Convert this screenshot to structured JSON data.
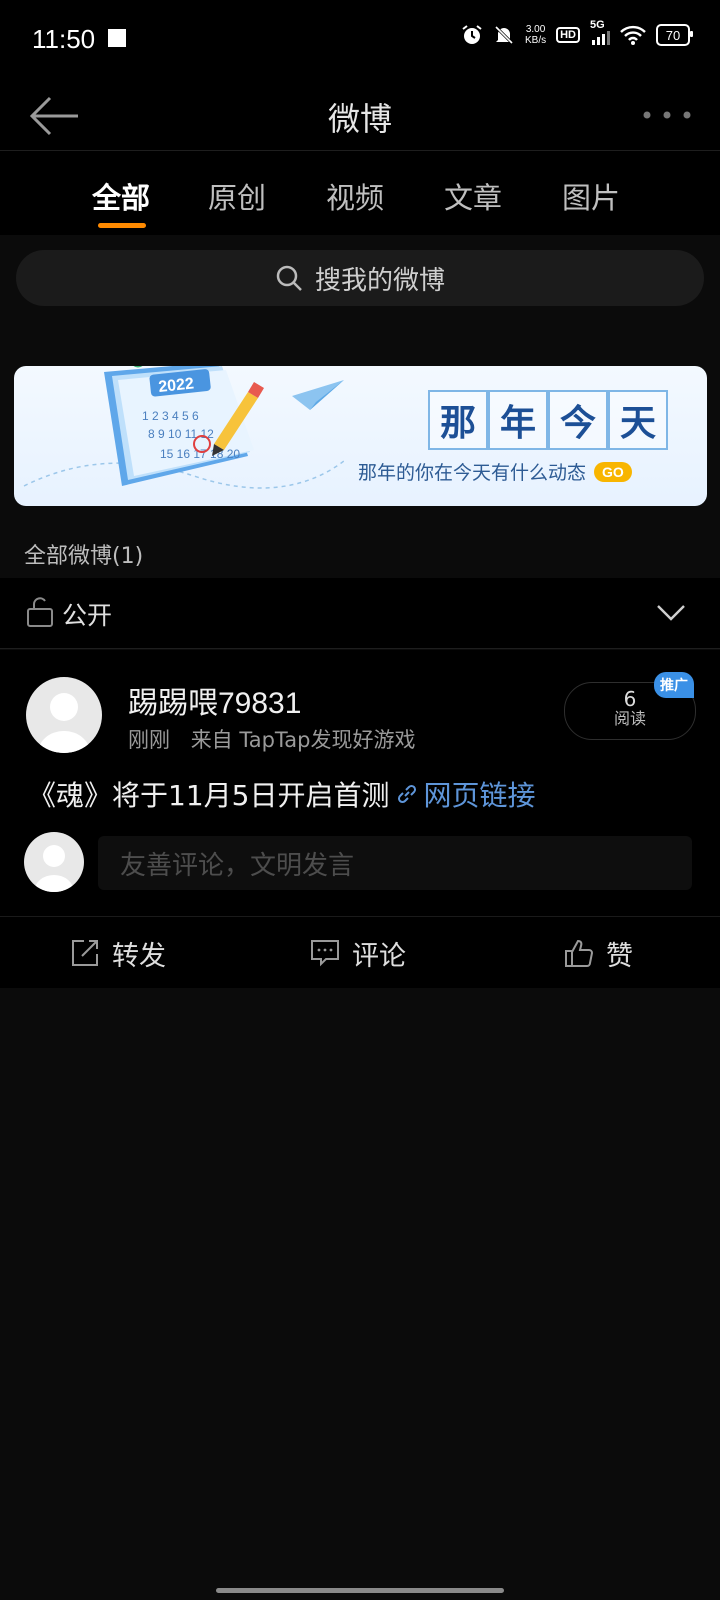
{
  "status": {
    "time": "11:50",
    "net_speed": "3.00",
    "net_unit": "KB/s",
    "hd": "HD",
    "signal": "5G",
    "battery": "70"
  },
  "header": {
    "title": "微博"
  },
  "tabs": [
    {
      "label": "全部",
      "active": true
    },
    {
      "label": "原创"
    },
    {
      "label": "视频"
    },
    {
      "label": "文章"
    },
    {
      "label": "图片"
    }
  ],
  "search": {
    "placeholder": "搜我的微博"
  },
  "banner": {
    "year": "2022",
    "title_chars": [
      "那",
      "年",
      "今",
      "天"
    ],
    "subtitle": "那年的你在今天有什么动态",
    "go": "GO"
  },
  "section": {
    "label": "全部微博(1)"
  },
  "privacy": {
    "label": "公开"
  },
  "post": {
    "user_name": "踢踢喂79831",
    "meta_time": "刚刚",
    "meta_source": "来自 TapTap发现好游戏",
    "read_count": "6",
    "read_label": "阅读",
    "promo_badge": "推广",
    "text": "《魂》将于11月5日开启首测",
    "link_label": "网页链接",
    "comment_placeholder": "友善评论，文明发言"
  },
  "actions": {
    "repost": "转发",
    "comment": "评论",
    "like": "赞"
  },
  "colors": {
    "accent": "#ff8a00",
    "link": "#5e95d9",
    "promo": "#3a90e6",
    "background": "#0b0b0b"
  }
}
